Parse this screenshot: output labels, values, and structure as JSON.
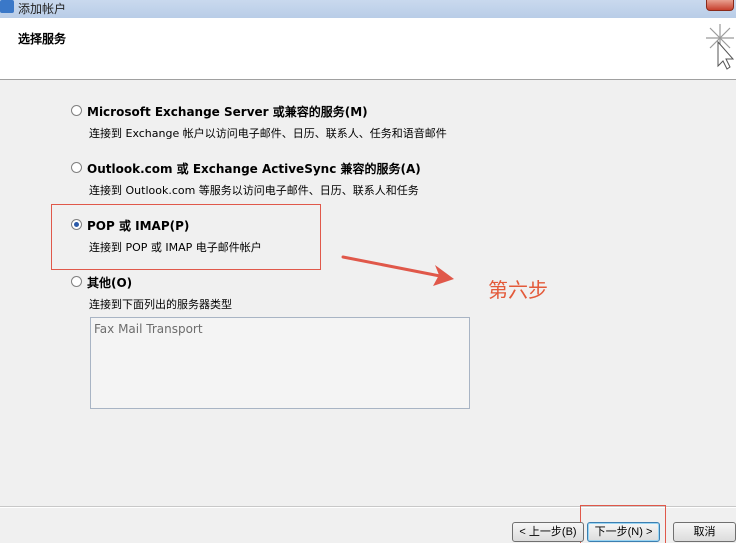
{
  "window": {
    "title": "添加帐户"
  },
  "header": {
    "heading": "选择服务"
  },
  "options": [
    {
      "label": "Microsoft Exchange Server 或兼容的服务(M)",
      "description": "连接到 Exchange 帐户以访问电子邮件、日历、联系人、任务和语音邮件",
      "selected": false
    },
    {
      "label": "Outlook.com 或 Exchange ActiveSync 兼容的服务(A)",
      "description": "连接到 Outlook.com 等服务以访问电子邮件、日历、联系人和任务",
      "selected": false
    },
    {
      "label": "POP 或 IMAP(P)",
      "description": "连接到 POP 或 IMAP 电子邮件帐户",
      "selected": true
    },
    {
      "label": "其他(O)",
      "description": "连接到下面列出的服务器类型",
      "selected": false
    }
  ],
  "server_types": [
    "Fax Mail Transport"
  ],
  "annotation": {
    "text": "第六步",
    "color": "#e35a3a"
  },
  "buttons": {
    "back": "< 上一步(B)",
    "next": "下一步(N) >",
    "cancel": "取消"
  },
  "colors": {
    "highlight": "#e0584a",
    "accent": "#2b5aa8"
  }
}
